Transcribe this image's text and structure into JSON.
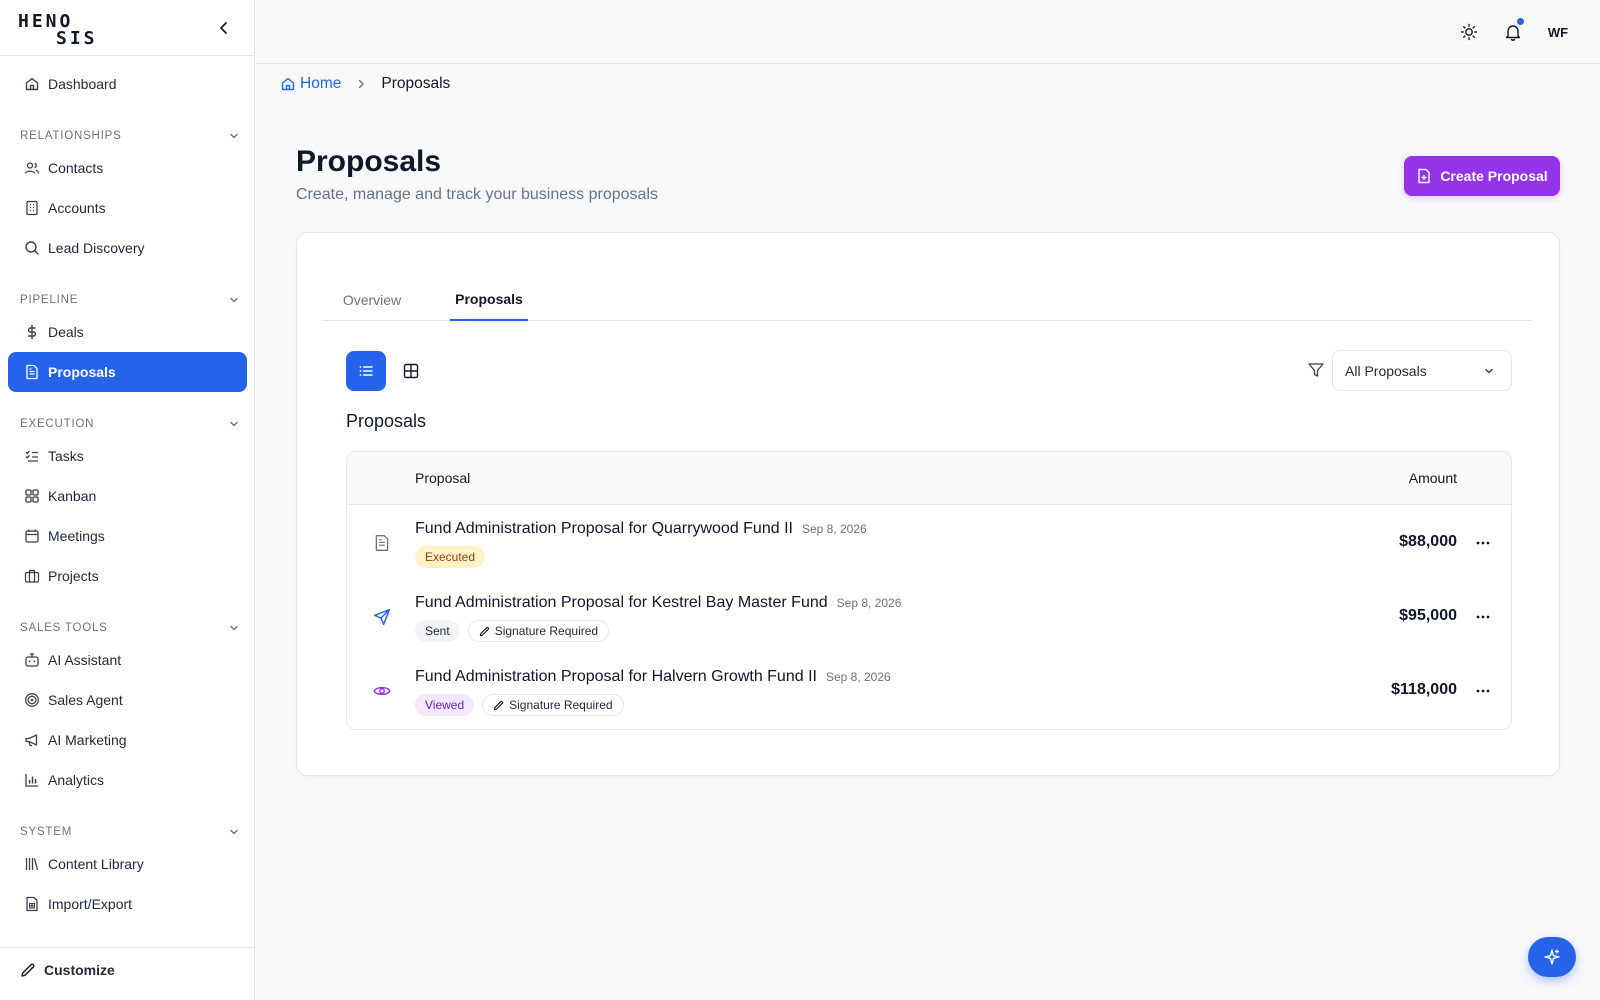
{
  "brand": {
    "line1": "HENO",
    "line2": "SIS"
  },
  "sidebar": {
    "dashboard": {
      "label": "Dashboard",
      "icon": "home-icon"
    },
    "sections": [
      {
        "label": "RELATIONSHIPS",
        "items": [
          {
            "label": "Contacts",
            "icon": "users-icon"
          },
          {
            "label": "Accounts",
            "icon": "building-icon"
          },
          {
            "label": "Lead Discovery",
            "icon": "search-icon"
          }
        ]
      },
      {
        "label": "PIPELINE",
        "items": [
          {
            "label": "Deals",
            "icon": "dollar-icon"
          },
          {
            "label": "Proposals",
            "icon": "document-icon",
            "active": true
          }
        ]
      },
      {
        "label": "EXECUTION",
        "items": [
          {
            "label": "Tasks",
            "icon": "list-check-icon"
          },
          {
            "label": "Kanban",
            "icon": "grid-icon"
          },
          {
            "label": "Meetings",
            "icon": "calendar-icon"
          },
          {
            "label": "Projects",
            "icon": "briefcase-icon"
          }
        ]
      },
      {
        "label": "SALES TOOLS",
        "items": [
          {
            "label": "AI Assistant",
            "icon": "bot-icon"
          },
          {
            "label": "Sales Agent",
            "icon": "target-icon"
          },
          {
            "label": "AI Marketing",
            "icon": "megaphone-icon"
          },
          {
            "label": "Analytics",
            "icon": "bar-chart-icon"
          }
        ]
      },
      {
        "label": "SYSTEM",
        "items": [
          {
            "label": "Content Library",
            "icon": "library-icon"
          },
          {
            "label": "Import/Export",
            "icon": "file-spreadsheet-icon"
          }
        ]
      }
    ],
    "footer": {
      "label": "Customize",
      "icon": "pencil-icon"
    }
  },
  "header": {
    "avatar_initials": "WF"
  },
  "breadcrumb": {
    "home": "Home",
    "current": "Proposals"
  },
  "page": {
    "title": "Proposals",
    "subtitle": "Create, manage and track your business proposals",
    "create_button": "Create Proposal"
  },
  "tabs": [
    "Overview",
    "Proposals"
  ],
  "filter": {
    "selected": "All Proposals"
  },
  "list": {
    "title": "Proposals",
    "columns": {
      "proposal": "Proposal",
      "amount": "Amount"
    },
    "rows": [
      {
        "name": "Fund Administration Proposal for Quarrywood Fund II",
        "date": "Sep 8, 2026",
        "status": "Executed",
        "signature": "",
        "amount": "$88,000",
        "icon": "document-icon"
      },
      {
        "name": "Fund Administration Proposal for Kestrel Bay Master Fund",
        "date": "Sep 8, 2026",
        "status": "Sent",
        "signature": "Signature Required",
        "amount": "$95,000",
        "icon": "send-icon"
      },
      {
        "name": "Fund Administration Proposal for Halvern Growth Fund II",
        "date": "Sep 8, 2026",
        "status": "Viewed",
        "signature": "Signature Required",
        "amount": "$118,000",
        "icon": "eye-icon"
      }
    ]
  },
  "colors": {
    "primary": "#2563eb",
    "accent": "#9333ea",
    "executed_bg": "#fef3c7",
    "viewed_bg": "#f3e8ff"
  }
}
